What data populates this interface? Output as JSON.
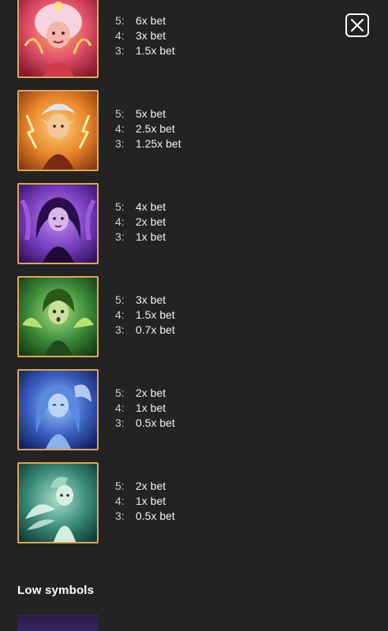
{
  "close": {
    "icon": "close-icon"
  },
  "symbols": [
    {
      "name": "pink-fairy-symbol",
      "payouts": [
        {
          "count": "5:",
          "amount": "6x bet"
        },
        {
          "count": "4:",
          "amount": "3x bet"
        },
        {
          "count": "3:",
          "amount": "1.5x bet"
        }
      ]
    },
    {
      "name": "orange-fairy-symbol",
      "payouts": [
        {
          "count": "5:",
          "amount": "5x bet"
        },
        {
          "count": "4:",
          "amount": "2.5x bet"
        },
        {
          "count": "3:",
          "amount": "1.25x bet"
        }
      ]
    },
    {
      "name": "purple-fairy-symbol",
      "payouts": [
        {
          "count": "5:",
          "amount": "4x bet"
        },
        {
          "count": "4:",
          "amount": "2x bet"
        },
        {
          "count": "3:",
          "amount": "1x bet"
        }
      ]
    },
    {
      "name": "green-fairy-symbol",
      "payouts": [
        {
          "count": "5:",
          "amount": "3x bet"
        },
        {
          "count": "4:",
          "amount": "1.5x bet"
        },
        {
          "count": "3:",
          "amount": "0.7x bet"
        }
      ]
    },
    {
      "name": "blue-fairy-symbol",
      "payouts": [
        {
          "count": "5:",
          "amount": "2x bet"
        },
        {
          "count": "4:",
          "amount": "1x bet"
        },
        {
          "count": "3:",
          "amount": "0.5x bet"
        }
      ]
    },
    {
      "name": "teal-fairy-symbol",
      "payouts": [
        {
          "count": "5:",
          "amount": "2x bet"
        },
        {
          "count": "4:",
          "amount": "1x bet"
        },
        {
          "count": "3:",
          "amount": "0.5x bet"
        }
      ]
    }
  ],
  "low_symbols": {
    "title": "Low symbols"
  },
  "colors": {
    "background": "#232323",
    "frame": "#e2a559",
    "pink_bg": "#e0506a",
    "orange_bg": "#e8852a",
    "purple_bg": "#7a3ec0",
    "green_bg": "#3a8a3a",
    "blue_bg": "#3a5fc0",
    "teal_bg": "#3a8a7a"
  }
}
